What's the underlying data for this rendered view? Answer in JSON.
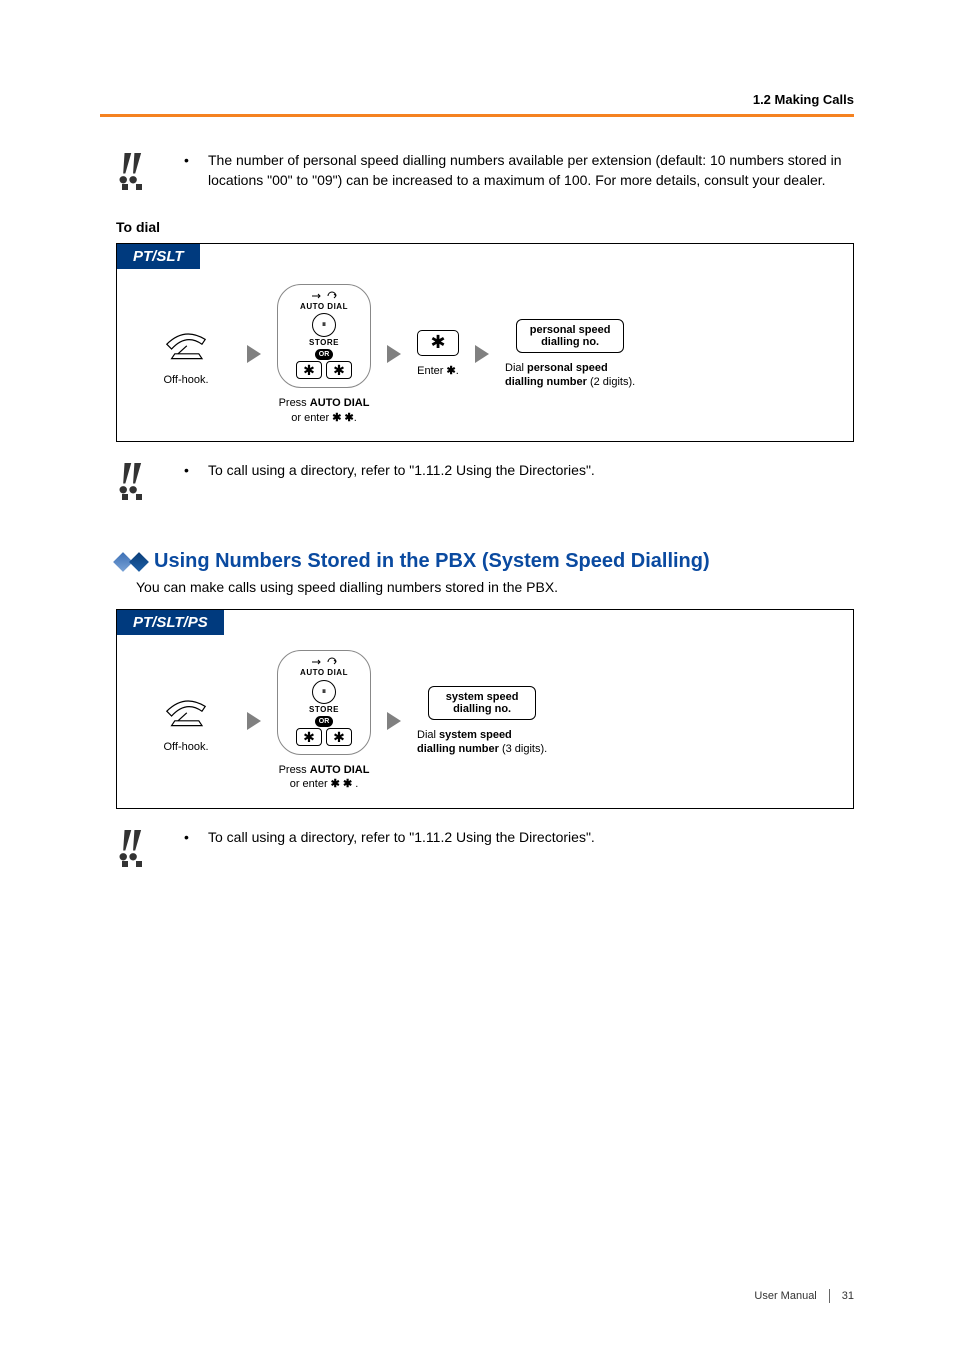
{
  "header": {
    "breadcrumb": "1.2 Making Calls"
  },
  "note1": {
    "text": "The number of personal speed dialling numbers available per extension (default: 10 numbers stored in locations \"00\" to \"09\") can be increased to a maximum of 100. For more details, consult your dealer."
  },
  "section1": {
    "title": "To dial",
    "tab": "PT/SLT",
    "step1_caption": "Off-hook.",
    "autodial": {
      "top": "AUTO DIAL",
      "pause": "⏸",
      "store": "STORE",
      "or": "OR",
      "star": "✱"
    },
    "step2_caption_prefix": "Press ",
    "step2_caption_bold": "AUTO DIAL",
    "step2_caption_line2_prefix": "or enter ",
    "step2_caption_line2_stars": "✱ ✱",
    "step2_caption_line2_suffix": ".",
    "step3_star": "✱",
    "step3_caption_prefix": "Enter ",
    "step3_caption_star": "✱",
    "step3_caption_suffix": ".",
    "step4_box_l1": "personal speed",
    "step4_box_l2": "dialling no.",
    "step4_caption_prefix": "Dial ",
    "step4_caption_bold": "personal speed",
    "step4_caption_line2_bold": "dialling number",
    "step4_caption_line2_suffix": " (2 digits)."
  },
  "note2": {
    "text": "To call using a directory, refer to \"1.11.2 Using the Directories\"."
  },
  "section2": {
    "heading": "Using Numbers Stored in the PBX (System Speed Dialling)",
    "intro": "You can make calls using speed dialling numbers stored in the PBX.",
    "tab": "PT/SLT/PS",
    "step1_caption": "Off-hook.",
    "step2_caption_prefix": "Press ",
    "step2_caption_bold": "AUTO DIAL",
    "step2_caption_line2_prefix": "or enter ",
    "step2_caption_line2_stars": "✱ ✱",
    "step2_caption_line2_suffix": " .",
    "step3_box_l1": "system speed",
    "step3_box_l2": "dialling no.",
    "step3_caption_prefix": "Dial ",
    "step3_caption_bold": "system speed",
    "step3_caption_line2_bold": "dialling number",
    "step3_caption_line2_suffix": " (3 digits)."
  },
  "note3": {
    "text": "To call using a directory, refer to \"1.11.2 Using the Directories\"."
  },
  "footer": {
    "label": "User Manual",
    "page": "31"
  }
}
